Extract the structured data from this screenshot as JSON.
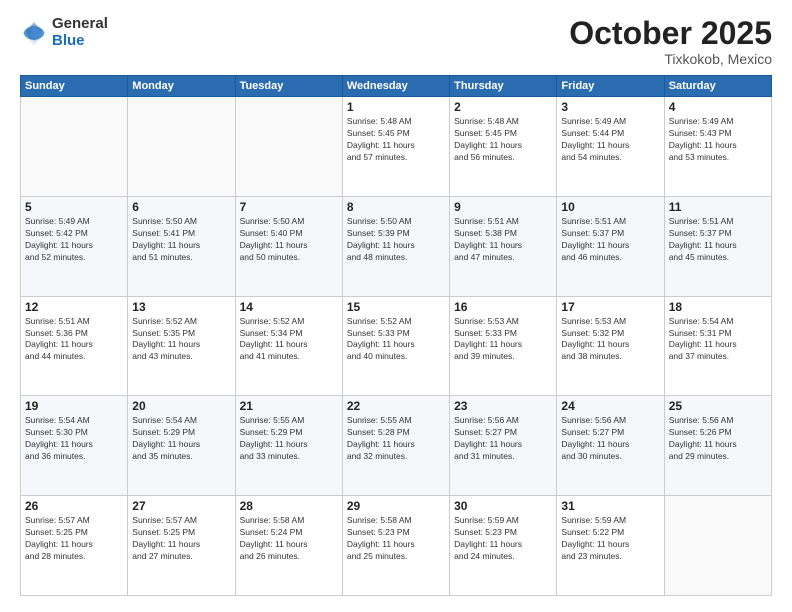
{
  "header": {
    "logo_general": "General",
    "logo_blue": "Blue",
    "month_title": "October 2025",
    "location": "Tixkokob, Mexico"
  },
  "weekdays": [
    "Sunday",
    "Monday",
    "Tuesday",
    "Wednesday",
    "Thursday",
    "Friday",
    "Saturday"
  ],
  "weeks": [
    [
      {
        "day": "",
        "info": ""
      },
      {
        "day": "",
        "info": ""
      },
      {
        "day": "",
        "info": ""
      },
      {
        "day": "1",
        "info": "Sunrise: 5:48 AM\nSunset: 5:45 PM\nDaylight: 11 hours\nand 57 minutes."
      },
      {
        "day": "2",
        "info": "Sunrise: 5:48 AM\nSunset: 5:45 PM\nDaylight: 11 hours\nand 56 minutes."
      },
      {
        "day": "3",
        "info": "Sunrise: 5:49 AM\nSunset: 5:44 PM\nDaylight: 11 hours\nand 54 minutes."
      },
      {
        "day": "4",
        "info": "Sunrise: 5:49 AM\nSunset: 5:43 PM\nDaylight: 11 hours\nand 53 minutes."
      }
    ],
    [
      {
        "day": "5",
        "info": "Sunrise: 5:49 AM\nSunset: 5:42 PM\nDaylight: 11 hours\nand 52 minutes."
      },
      {
        "day": "6",
        "info": "Sunrise: 5:50 AM\nSunset: 5:41 PM\nDaylight: 11 hours\nand 51 minutes."
      },
      {
        "day": "7",
        "info": "Sunrise: 5:50 AM\nSunset: 5:40 PM\nDaylight: 11 hours\nand 50 minutes."
      },
      {
        "day": "8",
        "info": "Sunrise: 5:50 AM\nSunset: 5:39 PM\nDaylight: 11 hours\nand 48 minutes."
      },
      {
        "day": "9",
        "info": "Sunrise: 5:51 AM\nSunset: 5:38 PM\nDaylight: 11 hours\nand 47 minutes."
      },
      {
        "day": "10",
        "info": "Sunrise: 5:51 AM\nSunset: 5:37 PM\nDaylight: 11 hours\nand 46 minutes."
      },
      {
        "day": "11",
        "info": "Sunrise: 5:51 AM\nSunset: 5:37 PM\nDaylight: 11 hours\nand 45 minutes."
      }
    ],
    [
      {
        "day": "12",
        "info": "Sunrise: 5:51 AM\nSunset: 5:36 PM\nDaylight: 11 hours\nand 44 minutes."
      },
      {
        "day": "13",
        "info": "Sunrise: 5:52 AM\nSunset: 5:35 PM\nDaylight: 11 hours\nand 43 minutes."
      },
      {
        "day": "14",
        "info": "Sunrise: 5:52 AM\nSunset: 5:34 PM\nDaylight: 11 hours\nand 41 minutes."
      },
      {
        "day": "15",
        "info": "Sunrise: 5:52 AM\nSunset: 5:33 PM\nDaylight: 11 hours\nand 40 minutes."
      },
      {
        "day": "16",
        "info": "Sunrise: 5:53 AM\nSunset: 5:33 PM\nDaylight: 11 hours\nand 39 minutes."
      },
      {
        "day": "17",
        "info": "Sunrise: 5:53 AM\nSunset: 5:32 PM\nDaylight: 11 hours\nand 38 minutes."
      },
      {
        "day": "18",
        "info": "Sunrise: 5:54 AM\nSunset: 5:31 PM\nDaylight: 11 hours\nand 37 minutes."
      }
    ],
    [
      {
        "day": "19",
        "info": "Sunrise: 5:54 AM\nSunset: 5:30 PM\nDaylight: 11 hours\nand 36 minutes."
      },
      {
        "day": "20",
        "info": "Sunrise: 5:54 AM\nSunset: 5:29 PM\nDaylight: 11 hours\nand 35 minutes."
      },
      {
        "day": "21",
        "info": "Sunrise: 5:55 AM\nSunset: 5:29 PM\nDaylight: 11 hours\nand 33 minutes."
      },
      {
        "day": "22",
        "info": "Sunrise: 5:55 AM\nSunset: 5:28 PM\nDaylight: 11 hours\nand 32 minutes."
      },
      {
        "day": "23",
        "info": "Sunrise: 5:56 AM\nSunset: 5:27 PM\nDaylight: 11 hours\nand 31 minutes."
      },
      {
        "day": "24",
        "info": "Sunrise: 5:56 AM\nSunset: 5:27 PM\nDaylight: 11 hours\nand 30 minutes."
      },
      {
        "day": "25",
        "info": "Sunrise: 5:56 AM\nSunset: 5:26 PM\nDaylight: 11 hours\nand 29 minutes."
      }
    ],
    [
      {
        "day": "26",
        "info": "Sunrise: 5:57 AM\nSunset: 5:25 PM\nDaylight: 11 hours\nand 28 minutes."
      },
      {
        "day": "27",
        "info": "Sunrise: 5:57 AM\nSunset: 5:25 PM\nDaylight: 11 hours\nand 27 minutes."
      },
      {
        "day": "28",
        "info": "Sunrise: 5:58 AM\nSunset: 5:24 PM\nDaylight: 11 hours\nand 26 minutes."
      },
      {
        "day": "29",
        "info": "Sunrise: 5:58 AM\nSunset: 5:23 PM\nDaylight: 11 hours\nand 25 minutes."
      },
      {
        "day": "30",
        "info": "Sunrise: 5:59 AM\nSunset: 5:23 PM\nDaylight: 11 hours\nand 24 minutes."
      },
      {
        "day": "31",
        "info": "Sunrise: 5:59 AM\nSunset: 5:22 PM\nDaylight: 11 hours\nand 23 minutes."
      },
      {
        "day": "",
        "info": ""
      }
    ]
  ]
}
